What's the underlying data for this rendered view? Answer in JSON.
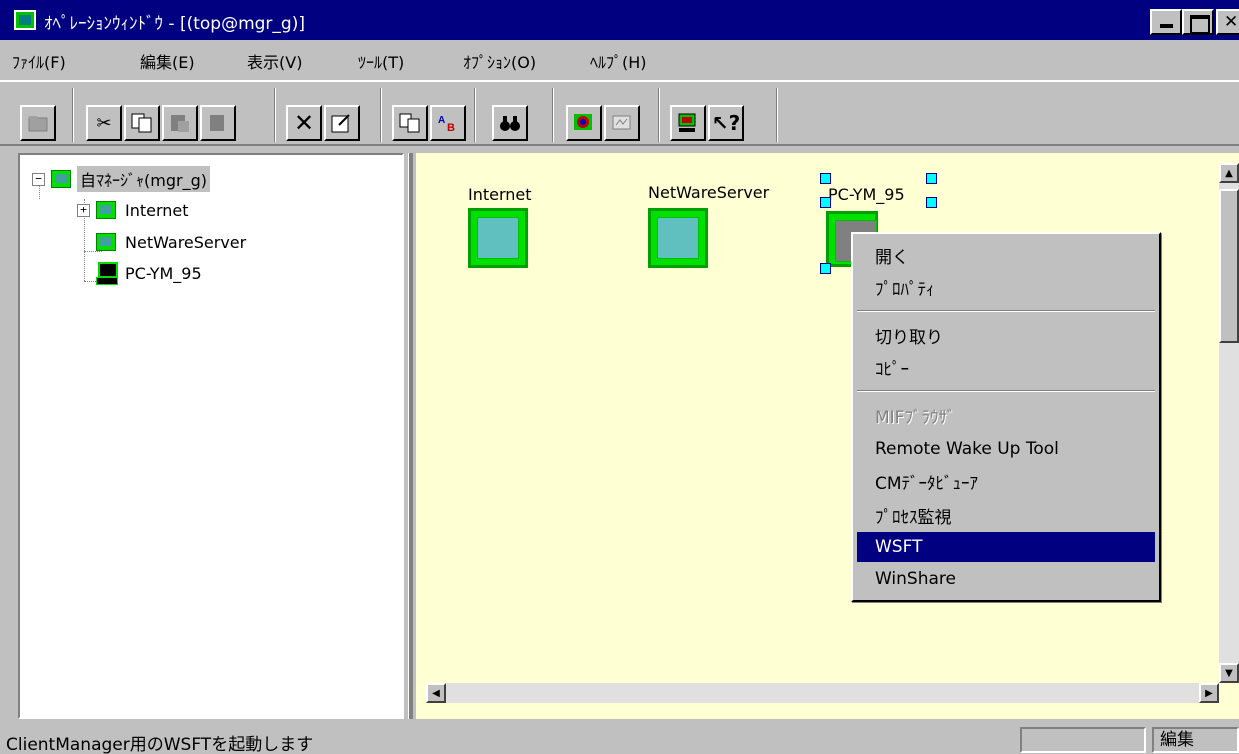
{
  "window": {
    "title": "ｵﾍﾟﾚｰｼｮﾝｳｨﾝﾄﾞｳ - [(top@mgr_g)]"
  },
  "menu": [
    {
      "label": "ﾌｧｲﾙ(F)"
    },
    {
      "label": "編集(E)"
    },
    {
      "label": "表示(V)"
    },
    {
      "label": "ﾂｰﾙ(T)"
    },
    {
      "label": "ｵﾌﾟｼｮﾝ(O)"
    },
    {
      "label": "ﾍﾙﾌﾟ(H)"
    }
  ],
  "toolbar": [
    {
      "icon": "folder-icon",
      "enabled": false
    },
    {
      "icon": "cut-icon",
      "enabled": true
    },
    {
      "icon": "copy-icon",
      "enabled": true
    },
    {
      "icon": "paste-icon",
      "enabled": false
    },
    {
      "icon": "paste-special-icon",
      "enabled": false
    },
    {
      "icon": "delete-icon",
      "enabled": true
    },
    {
      "icon": "properties-icon",
      "enabled": true
    },
    {
      "icon": "find-replace-icon",
      "enabled": true
    },
    {
      "icon": "rename-icon",
      "enabled": true
    },
    {
      "icon": "binoculars-icon",
      "enabled": true
    },
    {
      "icon": "map-view-icon",
      "enabled": true
    },
    {
      "icon": "monitor-icon",
      "enabled": true
    },
    {
      "icon": "network-icon",
      "enabled": true
    },
    {
      "icon": "help-pointer-icon",
      "enabled": true
    }
  ],
  "tree": {
    "root": {
      "label": "自ﾏﾈｰｼﾞｬ(mgr_g)",
      "expander": "−"
    },
    "children": [
      {
        "label": "Internet",
        "expander": "+"
      },
      {
        "label": "NetWareServer"
      },
      {
        "label": "PC-YM_95"
      }
    ]
  },
  "map": {
    "objects": [
      {
        "label": "Internet"
      },
      {
        "label": "NetWareServer"
      },
      {
        "label": "PC-YM_95"
      }
    ]
  },
  "context_menu": {
    "items": [
      {
        "label": "開く"
      },
      {
        "label": "ﾌﾟﾛﾊﾟﾃｨ"
      },
      {
        "label": "切り取り"
      },
      {
        "label": "ｺﾋﾟｰ"
      },
      {
        "label": "MIFﾌﾞﾗｳｻﾞ",
        "disabled": true
      },
      {
        "label": "Remote Wake Up Tool"
      },
      {
        "label": "CMﾃﾞｰﾀﾋﾞｭｰｱ"
      },
      {
        "label": "ﾌﾟﾛｾｽ監視"
      },
      {
        "label": "WSFT",
        "selected": true
      },
      {
        "label": "WinShare"
      }
    ]
  },
  "status": {
    "text": "ClientManager用のWSFTを起動します",
    "mode": "編集"
  },
  "colors": {
    "title_bar": "#000080",
    "map_background": "#ffffd4",
    "object_green": "#00e000",
    "selection": "#000080"
  }
}
